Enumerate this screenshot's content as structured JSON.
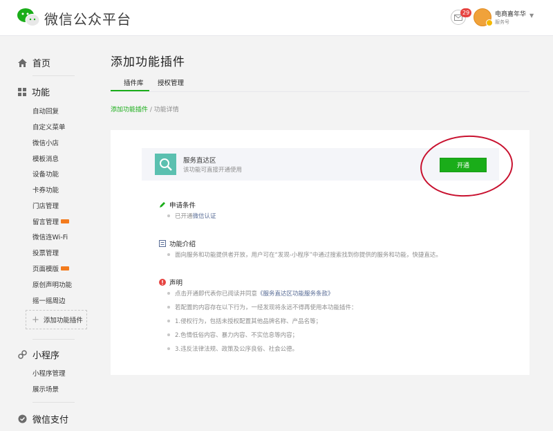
{
  "header": {
    "app_title": "微信公众平台",
    "mail_badge": "29",
    "account_name": "电商嘉年华",
    "account_type": "服务号"
  },
  "sidebar": {
    "home": "首页",
    "features_title": "功能",
    "feature_items": [
      "自动回复",
      "自定义菜单",
      "微信小店",
      "模板消息",
      "设备功能",
      "卡券功能",
      "门店管理",
      "留言管理",
      "微信连Wi-Fi",
      "投票管理",
      "页面模版",
      "原创声明功能",
      "摇一摇周边"
    ],
    "add_plugin": "添加功能插件",
    "miniprogram_title": "小程序",
    "miniprogram_items": [
      "小程序管理",
      "展示场景"
    ],
    "pay_title": "微信支付"
  },
  "main": {
    "page_title": "添加功能插件",
    "tabs": [
      "插件库",
      "授权管理"
    ],
    "breadcrumb": {
      "link": "添加功能插件",
      "separator": " / ",
      "current": "功能详情"
    },
    "plugin": {
      "name": "服务直达区",
      "description": "该功能可直接开通使用",
      "enable_label": "开通"
    },
    "requirements": {
      "title": "申请条件",
      "prefix": "已开通",
      "link": "微信认证"
    },
    "intro": {
      "title": "功能介绍",
      "text": "面向服务和功能提供者开放，用户可在“发现-小程序”中通过搜索找到你提供的服务和功能，快捷直达。"
    },
    "statement": {
      "title": "声明",
      "line1_prefix": "点击开通即代表你已阅读并同意",
      "line1_link": "《服务直达区功能服务条款》",
      "line2": "若配置的内容存在以下行为，一经发现将永远不得再使用本功能插件：",
      "line3": "1.侵权行为，包括未授权配置其他品牌名称、产品名等；",
      "line4": "2.色情低俗内容、暴力内容、不实信息等内容；",
      "line5": "3.违反法律法规、政策及公序良俗、社会公德。"
    }
  },
  "colors": {
    "brand_green": "#1aad19",
    "link_blue": "#576b95",
    "annotation_red": "#c8102e"
  }
}
